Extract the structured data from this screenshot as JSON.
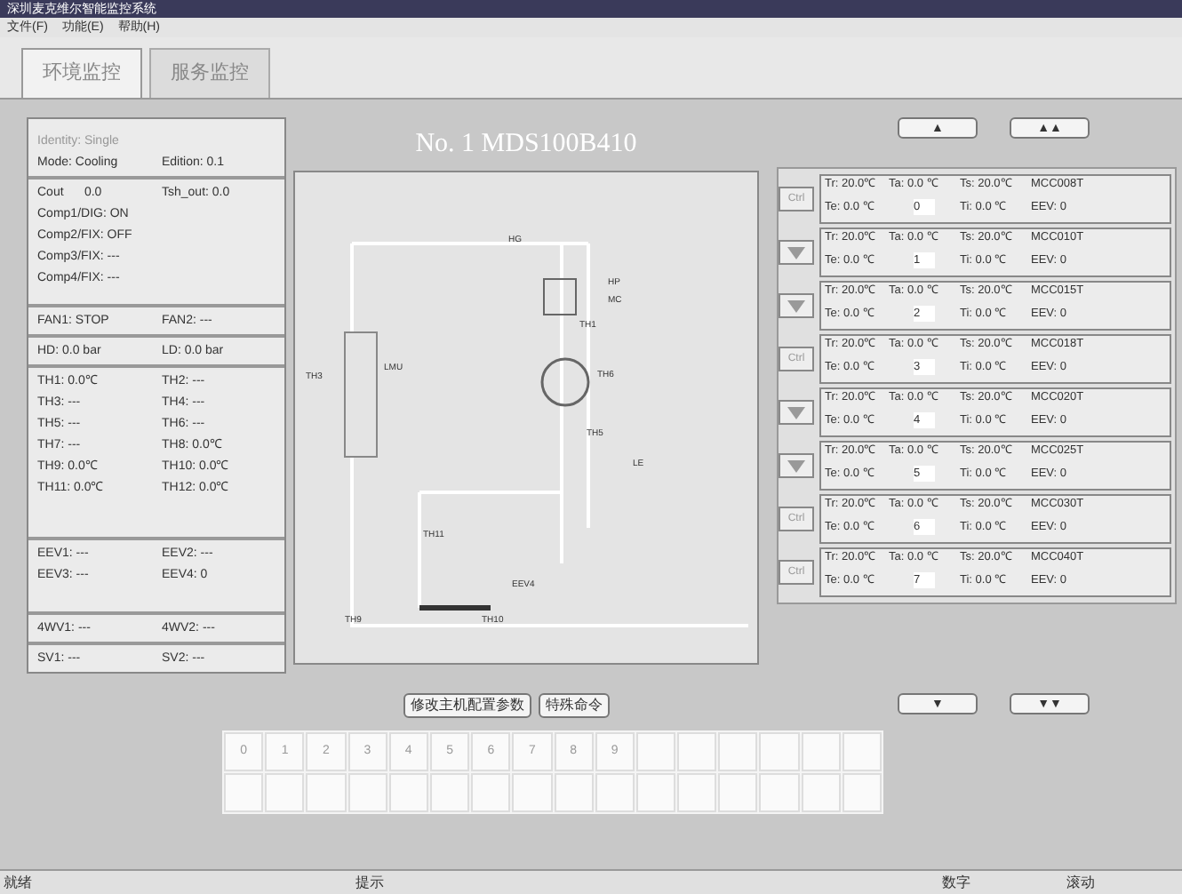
{
  "window": {
    "title": "深圳麦克维尔智能监控系统"
  },
  "menu": [
    "文件(F)",
    "功能(E)",
    "帮助(H)"
  ],
  "tabs": [
    {
      "label": "环境监控",
      "selected": true
    },
    {
      "label": "服务监控",
      "selected": false
    }
  ],
  "status_panel": {
    "groups": [
      {
        "rows": [
          [
            "Identity: Single"
          ],
          [
            "Mode: Cooling",
            "Edition: 0.1"
          ]
        ]
      },
      {
        "rows": [
          [
            "Cout      0.0",
            "Tsh_out: 0.0"
          ],
          [
            "Comp1/DIG: ON"
          ],
          [
            "Comp2/FIX: OFF"
          ],
          [
            "Comp3/FIX: ---"
          ],
          [
            "Comp4/FIX: ---"
          ]
        ]
      },
      {
        "rows": [
          [
            "FAN1: STOP",
            "FAN2: ---"
          ]
        ]
      },
      {
        "rows": [
          [
            "HD: 0.0 bar",
            "LD: 0.0 bar"
          ]
        ]
      },
      {
        "rows": [
          [
            "TH1: 0.0℃",
            "TH2: ---"
          ],
          [
            "TH3: ---",
            "TH4: ---"
          ],
          [
            "TH5: ---",
            "TH6: ---"
          ],
          [
            "TH7: ---",
            "TH8: 0.0℃"
          ],
          [
            "TH9: 0.0℃",
            "TH10: 0.0℃"
          ],
          [
            "TH11: 0.0℃",
            "TH12: 0.0℃"
          ]
        ]
      },
      {
        "rows": [
          [
            "EEV1: ---",
            "EEV2: ---"
          ],
          [
            "EEV3: ---",
            "EEV4: 0"
          ]
        ]
      },
      {
        "rows": [
          [
            "4WV1: ---",
            "4WV2: ---"
          ]
        ]
      },
      {
        "rows": [
          [
            "SV1: ---",
            "SV2: ---"
          ]
        ]
      }
    ]
  },
  "diagram": {
    "title": "No. 1    MDS100B410",
    "labels": [
      "HG",
      "HP",
      "MC",
      "TH1",
      "LMU",
      "TH3",
      "TH6",
      "TH5",
      "LE",
      "TH11",
      "EEV4",
      "TH9",
      "TH10"
    ]
  },
  "page_up_buttons": [
    "▲",
    "▲▲"
  ],
  "indoor_units": [
    {
      "control": "Ctrl",
      "kind": "text",
      "tr": "Tr: 20.0℃",
      "te": "Te: 0.0 ℃",
      "ta": "Ta: 0.0 ℃",
      "address": "0",
      "ts": "Ts: 20.0℃",
      "ti": "Ti: 0.0 ℃",
      "model": "MCC008T",
      "eev": "EEV: 0"
    },
    {
      "kind": "icon",
      "tr": "Tr: 20.0℃",
      "te": "Te: 0.0 ℃",
      "ta": "Ta: 0.0 ℃",
      "address": "1",
      "ts": "Ts: 20.0℃",
      "ti": "Ti: 0.0 ℃",
      "model": "MCC010T",
      "eev": "EEV: 0"
    },
    {
      "kind": "icon",
      "tr": "Tr: 20.0℃",
      "te": "Te: 0.0 ℃",
      "ta": "Ta: 0.0 ℃",
      "address": "2",
      "ts": "Ts: 20.0℃",
      "ti": "Ti: 0.0 ℃",
      "model": "MCC015T",
      "eev": "EEV: 0"
    },
    {
      "control": "Ctrl",
      "kind": "text",
      "tr": "Tr: 20.0℃",
      "te": "Te: 0.0 ℃",
      "ta": "Ta: 0.0 ℃",
      "address": "3",
      "ts": "Ts: 20.0℃",
      "ti": "Ti: 0.0 ℃",
      "model": "MCC018T",
      "eev": "EEV: 0"
    },
    {
      "kind": "icon",
      "tr": "Tr: 20.0℃",
      "te": "Te: 0.0 ℃",
      "ta": "Ta: 0.0 ℃",
      "address": "4",
      "ts": "Ts: 20.0℃",
      "ti": "Ti: 0.0 ℃",
      "model": "MCC020T",
      "eev": "EEV: 0"
    },
    {
      "kind": "icon",
      "tr": "Tr: 20.0℃",
      "te": "Te: 0.0 ℃",
      "ta": "Ta: 0.0 ℃",
      "address": "5",
      "ts": "Ts: 20.0℃",
      "ti": "Ti: 0.0 ℃",
      "model": "MCC025T",
      "eev": "EEV: 0"
    },
    {
      "control": "Ctrl",
      "kind": "text",
      "tr": "Tr: 20.0℃",
      "te": "Te: 0.0 ℃",
      "ta": "Ta: 0.0 ℃",
      "address": "6",
      "ts": "Ts: 20.0℃",
      "ti": "Ti: 0.0 ℃",
      "model": "MCC030T",
      "eev": "EEV: 0"
    },
    {
      "control": "Ctrl",
      "kind": "text",
      "tr": "Tr: 20.0℃",
      "te": "Te: 0.0 ℃",
      "ta": "Ta: 0.0 ℃",
      "address": "7",
      "ts": "Ts: 20.0℃",
      "ti": "Ti: 0.0 ℃",
      "model": "MCC040T",
      "eev": "EEV: 0"
    }
  ],
  "command_buttons": [
    "修改主机配置参数",
    "特殊命令"
  ],
  "page_down_buttons": [
    "▼",
    "▼▼"
  ],
  "keypad": {
    "keys": [
      "0",
      "1",
      "2",
      "3",
      "4",
      "5",
      "6",
      "7",
      "8",
      "9"
    ]
  },
  "status_bar": [
    "就绪",
    "提示",
    "数字",
    "滚动"
  ]
}
